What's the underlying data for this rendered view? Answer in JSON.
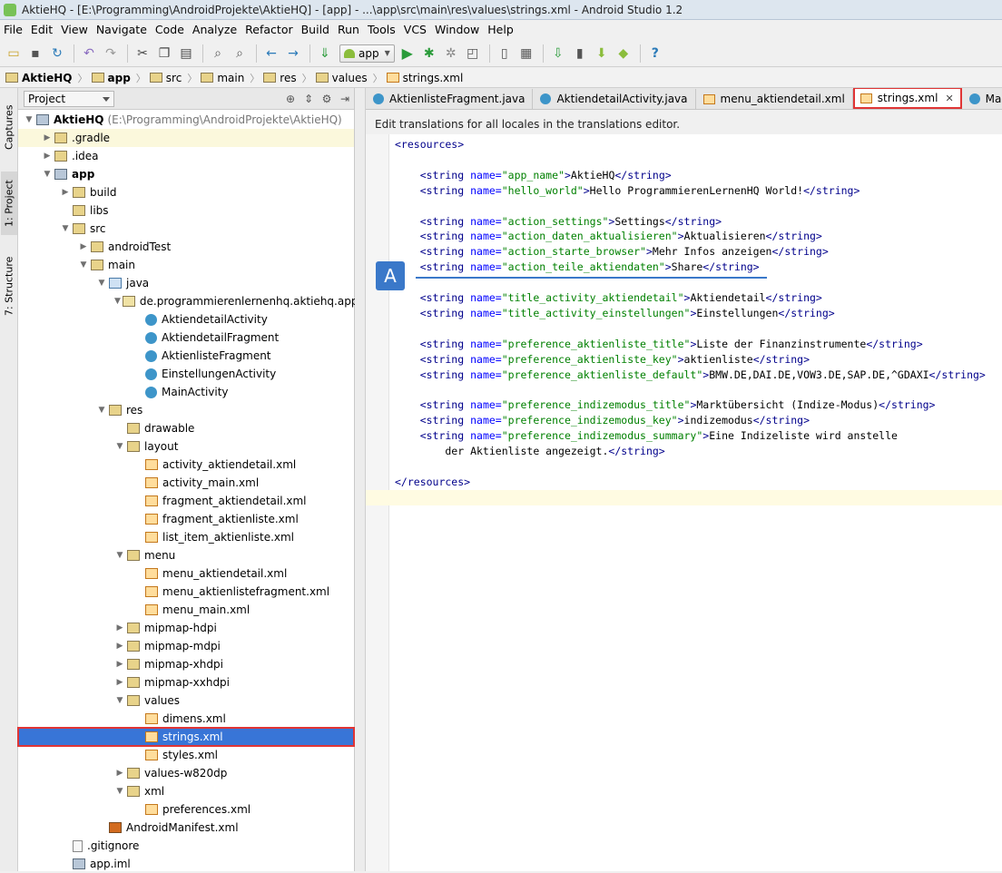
{
  "window": {
    "title": "AktieHQ - [E:\\Programming\\AndroidProjekte\\AktieHQ] - [app] - ...\\app\\src\\main\\res\\values\\strings.xml - Android Studio 1.2"
  },
  "menu": [
    "File",
    "Edit",
    "View",
    "Navigate",
    "Code",
    "Analyze",
    "Refactor",
    "Build",
    "Run",
    "Tools",
    "VCS",
    "Window",
    "Help"
  ],
  "toolbar": {
    "run_config": "app"
  },
  "breadcrumbs": [
    "AktieHQ",
    "app",
    "src",
    "main",
    "res",
    "values",
    "strings.xml"
  ],
  "side_tabs": {
    "captures": "Captures",
    "project": "1: Project",
    "structure": "7: Structure"
  },
  "panel": {
    "title": "Project"
  },
  "tree": [
    {
      "label": "AktieHQ",
      "extra": "(E:\\Programming\\AndroidProjekte\\AktieHQ)",
      "depth": 0,
      "expanded": true,
      "icon": "module-icon",
      "bold": true
    },
    {
      "label": ".gradle",
      "depth": 1,
      "expanded": false,
      "icon": "folder-icon",
      "highlight": true
    },
    {
      "label": ".idea",
      "depth": 1,
      "expanded": false,
      "icon": "folder-icon"
    },
    {
      "label": "app",
      "depth": 1,
      "expanded": true,
      "icon": "module-icon",
      "bold": true
    },
    {
      "label": "build",
      "depth": 2,
      "expanded": false,
      "icon": "folder-icon"
    },
    {
      "label": "libs",
      "depth": 2,
      "icon": "folder-icon"
    },
    {
      "label": "src",
      "depth": 2,
      "expanded": true,
      "icon": "folder-icon"
    },
    {
      "label": "androidTest",
      "depth": 3,
      "expanded": false,
      "icon": "folder-icon"
    },
    {
      "label": "main",
      "depth": 3,
      "expanded": true,
      "icon": "folder-icon"
    },
    {
      "label": "java",
      "depth": 4,
      "expanded": true,
      "icon": "java-folder-icon"
    },
    {
      "label": "de.programmierenlernenhq.aktiehq.app",
      "depth": 5,
      "expanded": true,
      "icon": "package-icon"
    },
    {
      "label": "AktiendetailActivity",
      "depth": 6,
      "icon": "class-icon"
    },
    {
      "label": "AktiendetailFragment",
      "depth": 6,
      "icon": "class-icon"
    },
    {
      "label": "AktienlisteFragment",
      "depth": 6,
      "icon": "class-icon"
    },
    {
      "label": "EinstellungenActivity",
      "depth": 6,
      "icon": "class-icon"
    },
    {
      "label": "MainActivity",
      "depth": 6,
      "icon": "class-icon"
    },
    {
      "label": "res",
      "depth": 4,
      "expanded": true,
      "icon": "res-folder-icon"
    },
    {
      "label": "drawable",
      "depth": 5,
      "icon": "folder-icon"
    },
    {
      "label": "layout",
      "depth": 5,
      "expanded": true,
      "icon": "folder-icon"
    },
    {
      "label": "activity_aktiendetail.xml",
      "depth": 6,
      "icon": "xml-file-icon"
    },
    {
      "label": "activity_main.xml",
      "depth": 6,
      "icon": "xml-file-icon"
    },
    {
      "label": "fragment_aktiendetail.xml",
      "depth": 6,
      "icon": "xml-file-icon"
    },
    {
      "label": "fragment_aktienliste.xml",
      "depth": 6,
      "icon": "xml-file-icon"
    },
    {
      "label": "list_item_aktienliste.xml",
      "depth": 6,
      "icon": "xml-file-icon"
    },
    {
      "label": "menu",
      "depth": 5,
      "expanded": true,
      "icon": "folder-icon"
    },
    {
      "label": "menu_aktiendetail.xml",
      "depth": 6,
      "icon": "xml-file-icon"
    },
    {
      "label": "menu_aktienlistefragment.xml",
      "depth": 6,
      "icon": "xml-file-icon"
    },
    {
      "label": "menu_main.xml",
      "depth": 6,
      "icon": "xml-file-icon"
    },
    {
      "label": "mipmap-hdpi",
      "depth": 5,
      "expanded": false,
      "icon": "folder-icon"
    },
    {
      "label": "mipmap-mdpi",
      "depth": 5,
      "expanded": false,
      "icon": "folder-icon"
    },
    {
      "label": "mipmap-xhdpi",
      "depth": 5,
      "expanded": false,
      "icon": "folder-icon"
    },
    {
      "label": "mipmap-xxhdpi",
      "depth": 5,
      "expanded": false,
      "icon": "folder-icon"
    },
    {
      "label": "values",
      "depth": 5,
      "expanded": true,
      "icon": "folder-icon"
    },
    {
      "label": "dimens.xml",
      "depth": 6,
      "icon": "xml-file-icon"
    },
    {
      "label": "strings.xml",
      "depth": 6,
      "icon": "xml-file-icon",
      "selected": true
    },
    {
      "label": "styles.xml",
      "depth": 6,
      "icon": "xml-file-icon"
    },
    {
      "label": "values-w820dp",
      "depth": 5,
      "expanded": false,
      "icon": "folder-icon"
    },
    {
      "label": "xml",
      "depth": 5,
      "expanded": true,
      "icon": "folder-icon"
    },
    {
      "label": "preferences.xml",
      "depth": 6,
      "icon": "xml-file-icon"
    },
    {
      "label": "AndroidManifest.xml",
      "depth": 4,
      "icon": "manifest-icon"
    },
    {
      "label": ".gitignore",
      "depth": 2,
      "icon": "text-file-icon"
    },
    {
      "label": "app.iml",
      "depth": 2,
      "icon": "iml-file-icon"
    }
  ],
  "tabs": [
    {
      "label": "AktienlisteFragment.java",
      "icon": "class-icon"
    },
    {
      "label": "AktiendetailActivity.java",
      "icon": "class-icon"
    },
    {
      "label": "menu_aktiendetail.xml",
      "icon": "xml-file-icon"
    },
    {
      "label": "strings.xml",
      "icon": "xml-file-icon",
      "active": true
    },
    {
      "label": "MainA",
      "icon": "class-icon"
    }
  ],
  "editor": {
    "banner": "Edit translations for all locales in the translations editor.",
    "badge": "A",
    "lines": [
      {
        "parts": [
          [
            "tag",
            "<resources>"
          ]
        ]
      },
      {
        "parts": []
      },
      {
        "parts": [
          [
            "tag",
            "    <string "
          ],
          [
            "attr",
            "name="
          ],
          [
            "val",
            "\"app_name\""
          ],
          [
            "tag",
            ">"
          ],
          [
            "txt",
            "AktieHQ"
          ],
          [
            "tag",
            "</string>"
          ]
        ]
      },
      {
        "parts": [
          [
            "tag",
            "    <string "
          ],
          [
            "attr",
            "name="
          ],
          [
            "val",
            "\"hello_world\""
          ],
          [
            "tag",
            ">"
          ],
          [
            "txt",
            "Hello ProgrammierenLernenHQ World!"
          ],
          [
            "tag",
            "</string>"
          ]
        ]
      },
      {
        "parts": []
      },
      {
        "parts": [
          [
            "tag",
            "    <string "
          ],
          [
            "attr",
            "name="
          ],
          [
            "val",
            "\"action_settings\""
          ],
          [
            "tag",
            ">"
          ],
          [
            "txt",
            "Settings"
          ],
          [
            "tag",
            "</string>"
          ]
        ]
      },
      {
        "parts": [
          [
            "tag",
            "    <string "
          ],
          [
            "attr",
            "name="
          ],
          [
            "val",
            "\"action_daten_aktualisieren\""
          ],
          [
            "tag",
            ">"
          ],
          [
            "txt",
            "Aktualisieren"
          ],
          [
            "tag",
            "</string>"
          ]
        ]
      },
      {
        "parts": [
          [
            "tag",
            "    <string "
          ],
          [
            "attr",
            "name="
          ],
          [
            "val",
            "\"action_starte_browser\""
          ],
          [
            "tag",
            ">"
          ],
          [
            "txt",
            "Mehr Infos anzeigen"
          ],
          [
            "tag",
            "</string>"
          ]
        ]
      },
      {
        "parts": [
          [
            "tag",
            "    <string "
          ],
          [
            "attr",
            "name="
          ],
          [
            "val",
            "\"action_teile_aktiendaten\""
          ],
          [
            "tag",
            ">"
          ],
          [
            "txt",
            "Share"
          ],
          [
            "tag",
            "</string>"
          ]
        ]
      },
      {
        "parts": []
      },
      {
        "parts": [
          [
            "tag",
            "    <string "
          ],
          [
            "attr",
            "name="
          ],
          [
            "val",
            "\"title_activity_aktiendetail\""
          ],
          [
            "tag",
            ">"
          ],
          [
            "txt",
            "Aktiendetail"
          ],
          [
            "tag",
            "</string>"
          ]
        ]
      },
      {
        "parts": [
          [
            "tag",
            "    <string "
          ],
          [
            "attr",
            "name="
          ],
          [
            "val",
            "\"title_activity_einstellungen\""
          ],
          [
            "tag",
            ">"
          ],
          [
            "txt",
            "Einstellungen"
          ],
          [
            "tag",
            "</string>"
          ]
        ]
      },
      {
        "parts": []
      },
      {
        "parts": [
          [
            "tag",
            "    <string "
          ],
          [
            "attr",
            "name="
          ],
          [
            "val",
            "\"preference_aktienliste_title\""
          ],
          [
            "tag",
            ">"
          ],
          [
            "txt",
            "Liste der Finanzinstrumente"
          ],
          [
            "tag",
            "</string>"
          ]
        ]
      },
      {
        "parts": [
          [
            "tag",
            "    <string "
          ],
          [
            "attr",
            "name="
          ],
          [
            "val",
            "\"preference_aktienliste_key\""
          ],
          [
            "tag",
            ">"
          ],
          [
            "txt",
            "aktienliste"
          ],
          [
            "tag",
            "</string>"
          ]
        ]
      },
      {
        "parts": [
          [
            "tag",
            "    <string "
          ],
          [
            "attr",
            "name="
          ],
          [
            "val",
            "\"preference_aktienliste_default\""
          ],
          [
            "tag",
            ">"
          ],
          [
            "txt",
            "BMW.DE,DAI.DE,VOW3.DE,SAP.DE,^GDAXI"
          ],
          [
            "tag",
            "</string>"
          ]
        ]
      },
      {
        "parts": []
      },
      {
        "parts": [
          [
            "tag",
            "    <string "
          ],
          [
            "attr",
            "name="
          ],
          [
            "val",
            "\"preference_indizemodus_title\""
          ],
          [
            "tag",
            ">"
          ],
          [
            "txt",
            "Marktübersicht (Indize-Modus)"
          ],
          [
            "tag",
            "</string>"
          ]
        ]
      },
      {
        "parts": [
          [
            "tag",
            "    <string "
          ],
          [
            "attr",
            "name="
          ],
          [
            "val",
            "\"preference_indizemodus_key\""
          ],
          [
            "tag",
            ">"
          ],
          [
            "txt",
            "indizemodus"
          ],
          [
            "tag",
            "</string>"
          ]
        ]
      },
      {
        "parts": [
          [
            "tag",
            "    <string "
          ],
          [
            "attr",
            "name="
          ],
          [
            "val",
            "\"preference_indizemodus_summary\""
          ],
          [
            "tag",
            ">"
          ],
          [
            "txt",
            "Eine Indizeliste wird anstelle"
          ]
        ]
      },
      {
        "parts": [
          [
            "txt",
            "        der Aktienliste angezeigt."
          ],
          [
            "tag",
            "</string>"
          ]
        ]
      },
      {
        "parts": []
      },
      {
        "parts": [
          [
            "tag",
            "</resources>"
          ]
        ]
      }
    ]
  }
}
